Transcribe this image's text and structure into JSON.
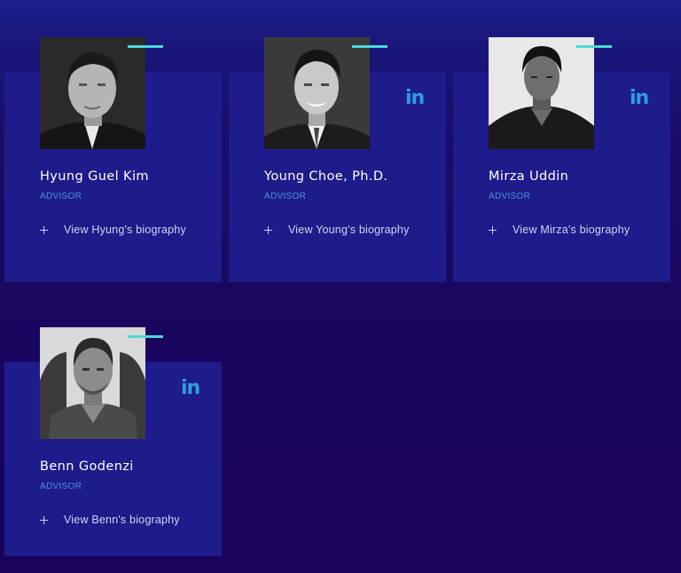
{
  "advisors": [
    {
      "name": "Hyung Guel Kim",
      "role": "ADVISOR",
      "bio_link": "View Hyung's biography",
      "linkedin": "",
      "has_linkedin": false,
      "photo": "portrait-hyung-guel-kim"
    },
    {
      "name": "Young Choe, Ph.D.",
      "role": "ADVISOR",
      "bio_link": "View Young's biography",
      "linkedin": "in",
      "has_linkedin": true,
      "photo": "portrait-young-choe"
    },
    {
      "name": "Mirza Uddin",
      "role": "ADVISOR",
      "bio_link": "View Mirza's biography",
      "linkedin": "in",
      "has_linkedin": true,
      "photo": "portrait-mirza-uddin"
    },
    {
      "name": "Benn Godenzi",
      "role": "ADVISOR",
      "bio_link": "View Benn's biography",
      "linkedin": "in",
      "has_linkedin": true,
      "photo": "portrait-benn-godenzi"
    }
  ],
  "colors": {
    "background": "#1a035c",
    "card": "#1e1c8a",
    "accent": "#4fd7d8",
    "linkedin": "#2d9fe0",
    "role": "#4f8fd8"
  }
}
